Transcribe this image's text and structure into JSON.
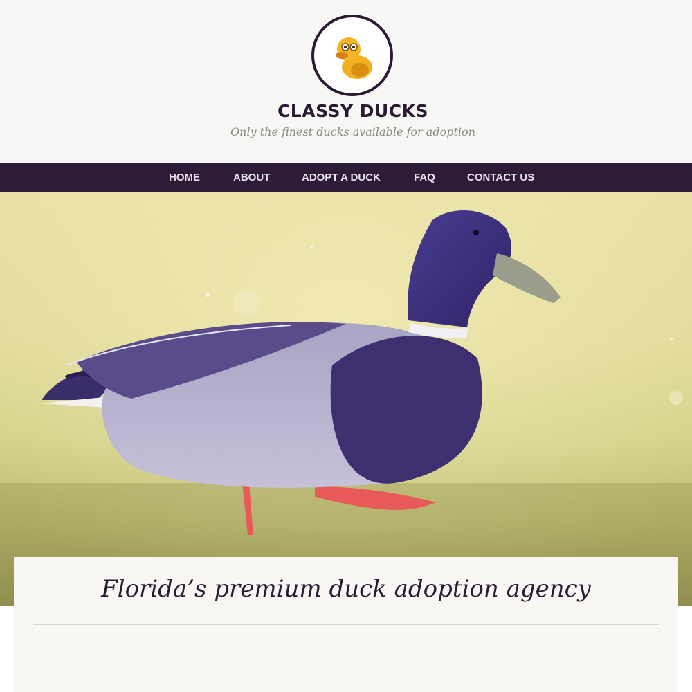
{
  "site": {
    "title": "CLASSY DUCKS",
    "tagline": "Only the finest ducks available for adoption",
    "logo_icon": "duck-logo-icon"
  },
  "nav": {
    "items": [
      {
        "label": "HOME"
      },
      {
        "label": "ABOUT"
      },
      {
        "label": "ADOPT A DUCK"
      },
      {
        "label": "FAQ"
      },
      {
        "label": "CONTACT US"
      }
    ]
  },
  "hero": {
    "image": "mallard duck walking on grass"
  },
  "content": {
    "headline": "Florida’s premium duck adoption agency"
  },
  "colors": {
    "brand_dark": "#2e1b38",
    "header_bg": "#f7f7f5",
    "tagline": "#8a8a80",
    "logo_duck": "#f0b020"
  }
}
